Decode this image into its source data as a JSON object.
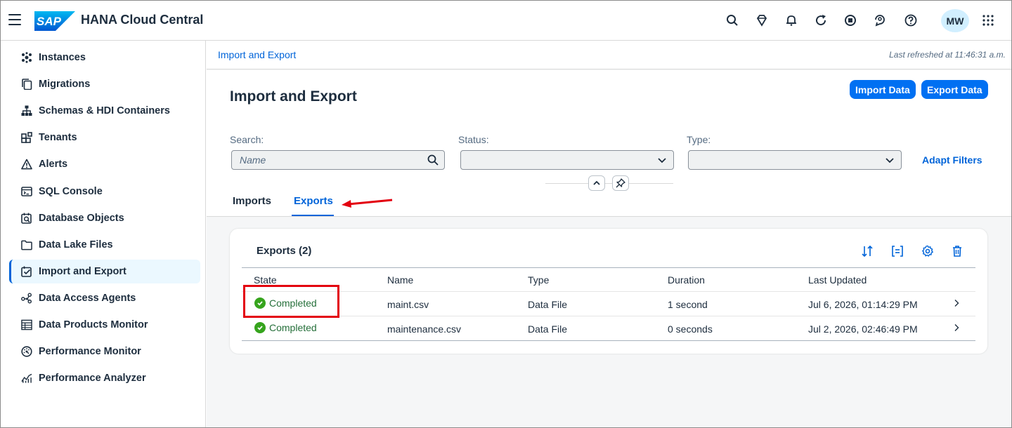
{
  "shell": {
    "app_title": "HANA Cloud Central",
    "avatar_initials": "MW",
    "logo_text": "SAP"
  },
  "sidebar": {
    "items": [
      {
        "label": "Instances",
        "icon": "instances-icon"
      },
      {
        "label": "Migrations",
        "icon": "migrations-icon"
      },
      {
        "label": "Schemas & HDI Containers",
        "icon": "schemas-icon"
      },
      {
        "label": "Tenants",
        "icon": "tenants-icon"
      },
      {
        "label": "Alerts",
        "icon": "alert-icon"
      },
      {
        "label": "SQL Console",
        "icon": "sql-console-icon"
      },
      {
        "label": "Database Objects",
        "icon": "database-objects-icon"
      },
      {
        "label": "Data Lake Files",
        "icon": "folder-icon"
      },
      {
        "label": "Import and Export",
        "icon": "import-export-icon",
        "active": true
      },
      {
        "label": "Data Access Agents",
        "icon": "data-access-agents-icon"
      },
      {
        "label": "Data Products Monitor",
        "icon": "data-products-icon"
      },
      {
        "label": "Performance Monitor",
        "icon": "performance-monitor-icon"
      },
      {
        "label": "Performance Analyzer",
        "icon": "performance-analyzer-icon"
      }
    ]
  },
  "breadcrumb": "Import and Export",
  "last_refreshed": "Last refreshed at 11:46:31 a.m.",
  "page": {
    "title": "Import and Export",
    "import_button": "Import Data",
    "export_button": "Export Data"
  },
  "filters": {
    "search_label": "Search:",
    "search_placeholder": "Name",
    "status_label": "Status:",
    "type_label": "Type:",
    "adapt_filters": "Adapt Filters"
  },
  "tabs": {
    "imports": "Imports",
    "exports": "Exports",
    "selected": "Exports"
  },
  "table": {
    "title": "Exports (2)",
    "columns": [
      "State",
      "Name",
      "Type",
      "Duration",
      "Last Updated"
    ],
    "rows": [
      {
        "state": "Completed",
        "name": "maint.csv",
        "type": "Data File",
        "duration": "1 second",
        "last_updated": "Jul 6, 2026, 01:14:29 PM"
      },
      {
        "state": "Completed",
        "name": "maintenance.csv",
        "type": "Data File",
        "duration": "0 seconds",
        "last_updated": "Jul 2, 2026, 02:46:49 PM"
      }
    ]
  },
  "colors": {
    "brand_blue": "#0070f2",
    "link_blue": "#0064d9",
    "success_green": "#36a41d",
    "annotation_red": "#e3000f"
  }
}
